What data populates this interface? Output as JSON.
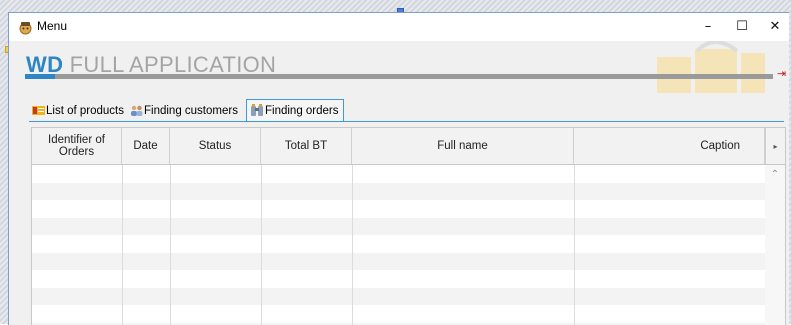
{
  "window": {
    "title": "Menu",
    "minimize_glyph": "–",
    "maximize_glyph": "☐",
    "close_glyph": "✕"
  },
  "banner": {
    "title_prefix": "WD",
    "title_rest": " FULL APPLICATION",
    "progress_fraction": 0.04,
    "accent_color": "#2f86c5",
    "logout_icon": "logout-icon"
  },
  "tabs": [
    {
      "label": "List of products",
      "icon": "product-list-icon",
      "active": false
    },
    {
      "label": "Finding customers",
      "icon": "customers-icon",
      "active": false
    },
    {
      "label": "Finding orders",
      "icon": "binoculars-icon",
      "active": true
    }
  ],
  "table": {
    "columns": [
      {
        "label": "Identifier of Orders"
      },
      {
        "label": "Date"
      },
      {
        "label": "Status"
      },
      {
        "label": "Total BT"
      },
      {
        "label": "Full name"
      },
      {
        "label": "Caption"
      }
    ],
    "rows": []
  }
}
